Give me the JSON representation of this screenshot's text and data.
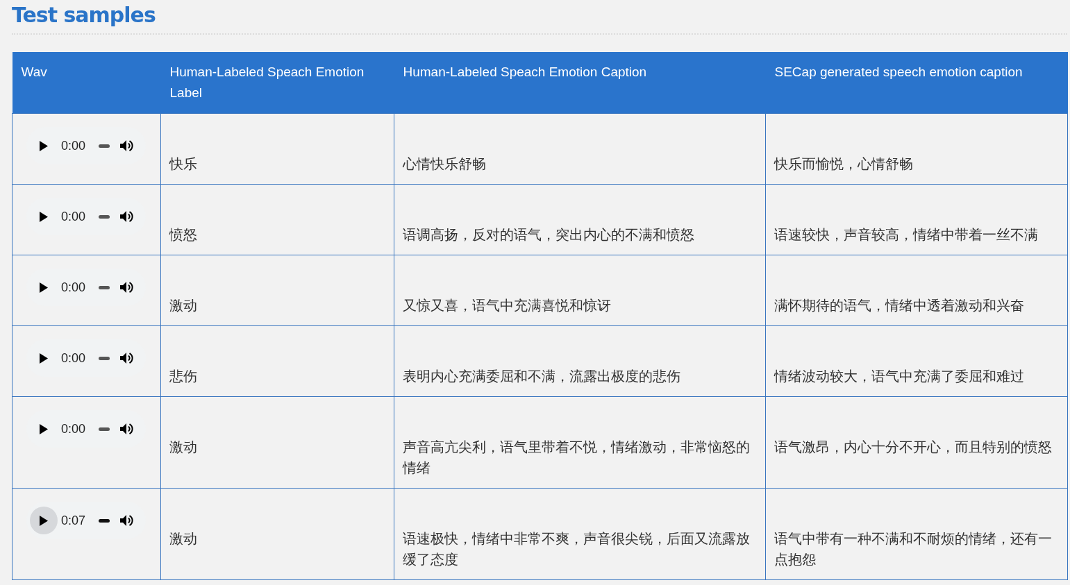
{
  "heading": "Test samples",
  "table": {
    "columns": [
      "Wav",
      "Human-Labeled Speach Emotion Label",
      "Human-Labeled Speach Emotion Caption",
      "SECap generated speech emotion caption"
    ],
    "rows": [
      {
        "wav": {
          "time": "0:00",
          "hovered": false,
          "level": 0
        },
        "label": "快乐",
        "caption": "心情快乐舒畅",
        "generated": "快乐而愉悦，心情舒畅"
      },
      {
        "wav": {
          "time": "0:00",
          "hovered": false,
          "level": 0
        },
        "label": "愤怒",
        "caption": "语调高扬，反对的语气，突出内心的不满和愤怒",
        "generated": "语速较快，声音较高，情绪中带着一丝不满"
      },
      {
        "wav": {
          "time": "0:00",
          "hovered": false,
          "level": 0
        },
        "label": "激动",
        "caption": "又惊又喜，语气中充满喜悦和惊讶",
        "generated": "满怀期待的语气，情绪中透着激动和兴奋"
      },
      {
        "wav": {
          "time": "0:00",
          "hovered": false,
          "level": 0
        },
        "label": "悲伤",
        "caption": "表明内心充满委屈和不满，流露出极度的悲伤",
        "generated": "情绪波动较大，语气中充满了委屈和难过"
      },
      {
        "wav": {
          "time": "0:00",
          "hovered": false,
          "level": 0
        },
        "label": "激动",
        "caption": "声音高亢尖利，语气里带着不悦，情绪激动，非常恼怒的情绪",
        "generated": "语气激昂，内心十分不开心，而且特别的愤怒"
      },
      {
        "wav": {
          "time": "0:07",
          "hovered": true,
          "level": 0
        },
        "label": "激动",
        "caption": "语速极快，情绪中非常不爽，声音很尖锐，后面又流露放缓了态度",
        "generated": "语气中带有一种不满和不耐烦的情绪，还有一点抱怨"
      }
    ]
  }
}
